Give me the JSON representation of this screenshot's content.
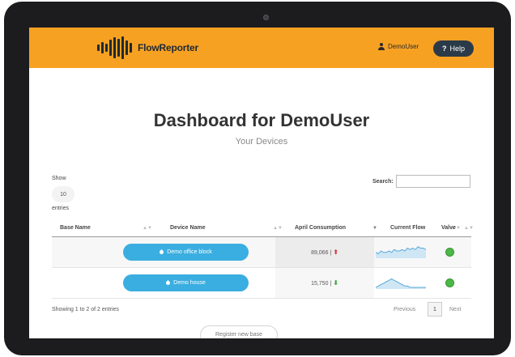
{
  "header": {
    "app_name": "FlowReporter",
    "user_name": "DemoUser",
    "help_label": "Help",
    "help_icon_glyph": "?",
    "brand_color": "#f7a123"
  },
  "page": {
    "title": "Dashboard for DemoUser",
    "subtitle": "Your Devices"
  },
  "controls": {
    "show_label": "Show",
    "page_length": "10",
    "entries_label": "entries",
    "search_label": "Search:",
    "search_value": ""
  },
  "table": {
    "columns": [
      "Base Name",
      "Device Name",
      "April Consumption",
      "Current Flow",
      "Valve"
    ],
    "rows": [
      {
        "base_name": "",
        "device_name": "Demo office block",
        "consumption": "89,066",
        "separator": "|",
        "trend": "up",
        "trend_glyph": "⬆",
        "trend_color": "#d9363e",
        "valve_status_color": "#4bb848",
        "flow": [
          3,
          2,
          4,
          3,
          3,
          4,
          3,
          5,
          4,
          4,
          5,
          4,
          6,
          5,
          6,
          5,
          7,
          6,
          6,
          5
        ]
      },
      {
        "base_name": "",
        "device_name": "Demo house",
        "consumption": "15,750",
        "separator": "|",
        "trend": "down",
        "trend_glyph": "⬇",
        "trend_color": "#3aa63a",
        "valve_status_color": "#4bb848",
        "flow": [
          0,
          1,
          2,
          3,
          4,
          5,
          6,
          5,
          4,
          3,
          2,
          1,
          1,
          0,
          0,
          0,
          0,
          0,
          0,
          0
        ]
      }
    ]
  },
  "footer": {
    "showing_text": "Showing 1 to 2 of 2 entries",
    "previous_label": "Previous",
    "current_page": "1",
    "next_label": "Next",
    "register_label": "Register new base"
  }
}
